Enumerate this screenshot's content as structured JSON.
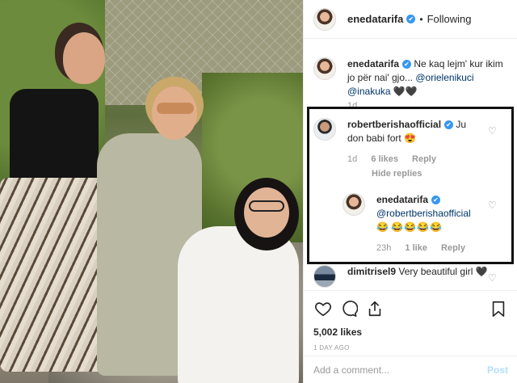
{
  "post": {
    "username": "enedatarifa",
    "follow_status": "Following",
    "separator": "•"
  },
  "caption": {
    "username": "enedatarifa",
    "text": "Ne kaq lejm' kur ikim jo për nai' gjo...",
    "mention1": "@orielenikuci",
    "mention2": "@inakuka",
    "hearts": "🖤🖤",
    "time": "1d"
  },
  "comments": [
    {
      "username": "robertberishaofficial",
      "text": "Ju don babi fort",
      "emoji": "😍",
      "time": "1d",
      "likes": "6 likes",
      "reply": "Reply",
      "hide_replies": "Hide replies"
    },
    {
      "username": "enedatarifa",
      "mention": "@robertberishaofficial",
      "emoji1": "😂",
      "emojis": "😂😂😂😂",
      "time": "23h",
      "likes": "1 like",
      "reply": "Reply"
    },
    {
      "username": "dimitrisel9",
      "text": "Very beautiful girl",
      "emoji": "🖤"
    }
  ],
  "actions": {
    "likes": "5,002 likes",
    "time_ago": "1 DAY AGO"
  },
  "add_comment": {
    "placeholder": "Add a comment...",
    "post_label": "Post"
  },
  "icons": {
    "verified": "✔",
    "heart": "♡",
    "like": "heart-icon",
    "comment": "comment-icon",
    "share": "share-icon",
    "save": "bookmark-icon"
  }
}
